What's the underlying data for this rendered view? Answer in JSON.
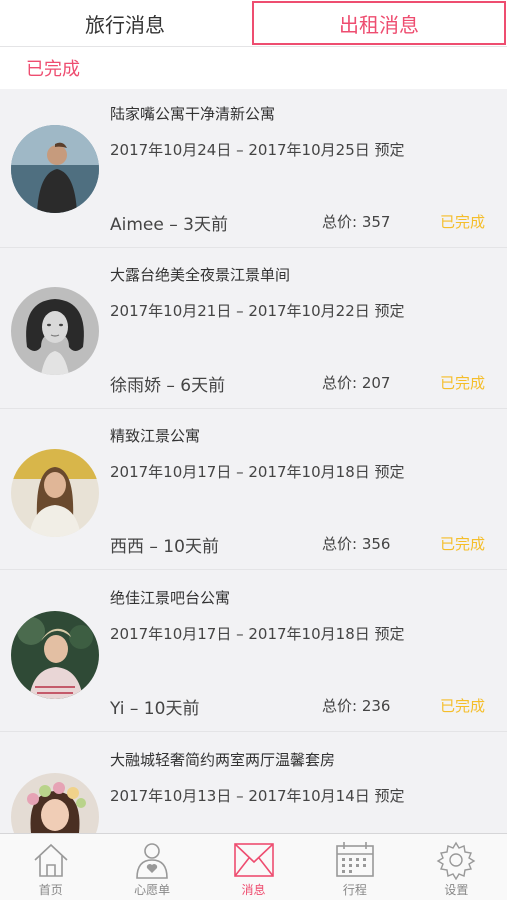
{
  "tabs": [
    {
      "label": "旅行消息",
      "active": false
    },
    {
      "label": "出租消息",
      "active": true
    }
  ],
  "filter": {
    "label": "已完成"
  },
  "orders": [
    {
      "title": "陆家嘴公寓干净清新公寓",
      "dates": "2017年10月24日 – 2017年10月25日 预定",
      "guest": "Aimee – 3天前",
      "price": "总价:  357",
      "status": "已完成"
    },
    {
      "title": "大露台绝美全夜景江景单间",
      "dates": "2017年10月21日 – 2017年10月22日 预定",
      "guest": "徐雨娇 – 6天前",
      "price": "总价:  207",
      "status": "已完成"
    },
    {
      "title": "精致江景公寓",
      "dates": "2017年10月17日 – 2017年10月18日 预定",
      "guest": "西西 – 10天前",
      "price": "总价:  356",
      "status": "已完成"
    },
    {
      "title": "绝佳江景吧台公寓",
      "dates": "2017年10月17日 – 2017年10月18日 预定",
      "guest": "Yi – 10天前",
      "price": "总价:  236",
      "status": "已完成"
    },
    {
      "title": "大融城轻奢简约两室两厅温馨套房",
      "dates": "2017年10月13日 – 2017年10月14日 预定",
      "guest": "",
      "price": "",
      "status": ""
    }
  ],
  "tabbar": [
    {
      "label": "首页",
      "icon": "home-icon",
      "active": false
    },
    {
      "label": "心愿单",
      "icon": "wishlist-icon",
      "active": false
    },
    {
      "label": "消息",
      "icon": "message-icon",
      "active": true
    },
    {
      "label": "行程",
      "icon": "calendar-icon",
      "active": false
    },
    {
      "label": "设置",
      "icon": "settings-icon",
      "active": false
    }
  ],
  "colors": {
    "accent": "#ee4d70",
    "status": "#f5be2a",
    "background": "#f2f2f4"
  }
}
